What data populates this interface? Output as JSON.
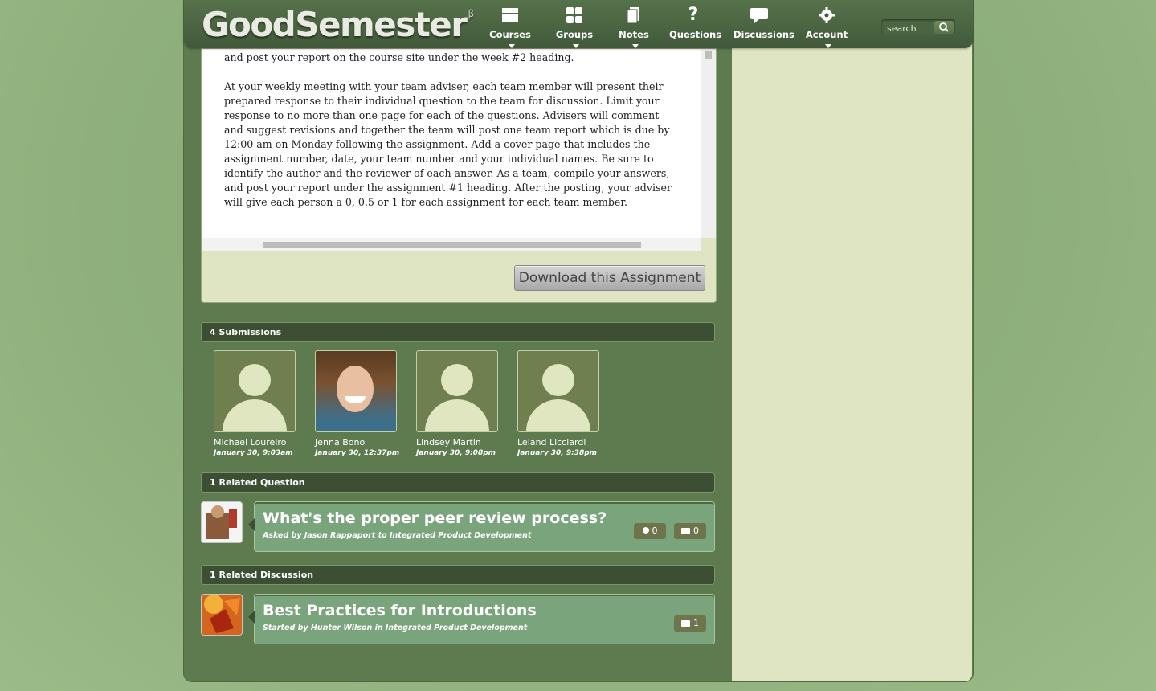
{
  "brand": {
    "name": "GoodSemester",
    "mark": "β"
  },
  "nav": [
    {
      "label": "Courses",
      "icon": "courses-icon",
      "dropdown": true
    },
    {
      "label": "Groups",
      "icon": "groups-icon",
      "dropdown": true
    },
    {
      "label": "Notes",
      "icon": "notes-icon",
      "dropdown": true
    },
    {
      "label": "Questions",
      "icon": "question-icon",
      "dropdown": false
    },
    {
      "label": "Discussions",
      "icon": "discussion-icon",
      "dropdown": false
    },
    {
      "label": "Account",
      "icon": "gear-icon",
      "dropdown": true
    }
  ],
  "search": {
    "placeholder": "search"
  },
  "assignment": {
    "paragraphs": [
      "and post your report on the course site under the week #2 heading.",
      "At your weekly meeting with your team adviser, each team member will present their prepared response to their individual question to the team for discussion. Limit your response to no more than one page for each of the questions.  Advisers will comment and suggest revisions and together the team will post one team report which is due by 12:00 am on Monday following the assignment.  Add a cover page that includes the assignment number, date, your team number and your individual names. Be sure to identify the author and the reviewer of each answer. As a team, compile your answers, and post your report under the assignment #1 heading. After the posting, your adviser will give each person a 0, 0.5 or 1 for each assignment for each team member."
    ],
    "download_label": "Download this Assignment"
  },
  "submissions": {
    "header": "4 Submissions",
    "items": [
      {
        "name": "Michael Loureiro",
        "date": "January 30, 9:03am"
      },
      {
        "name": "Jenna Bono",
        "date": "January 30, 12:37pm"
      },
      {
        "name": "Lindsey Martin",
        "date": "January 30, 9:08pm"
      },
      {
        "name": "Leland Licciardi",
        "date": "January 30, 9:38pm"
      }
    ]
  },
  "related_question": {
    "header": "1 Related Question",
    "title": "What's the proper peer review process?",
    "byline": "Asked by Jason Rappaport to Integrated Product Development",
    "votes": "0",
    "comments": "0"
  },
  "related_discussion": {
    "header": "1 Related Discussion",
    "title": "Best Practices for Introductions",
    "byline": "Started by Hunter Wilson in Integrated Product Development",
    "comments": "1"
  },
  "colors": {
    "page_bg": "#8fb07c",
    "panel": "#5e7a4f",
    "header": "#41593a",
    "sidebar": "#dfe4c3",
    "card": "#7aa57c"
  }
}
